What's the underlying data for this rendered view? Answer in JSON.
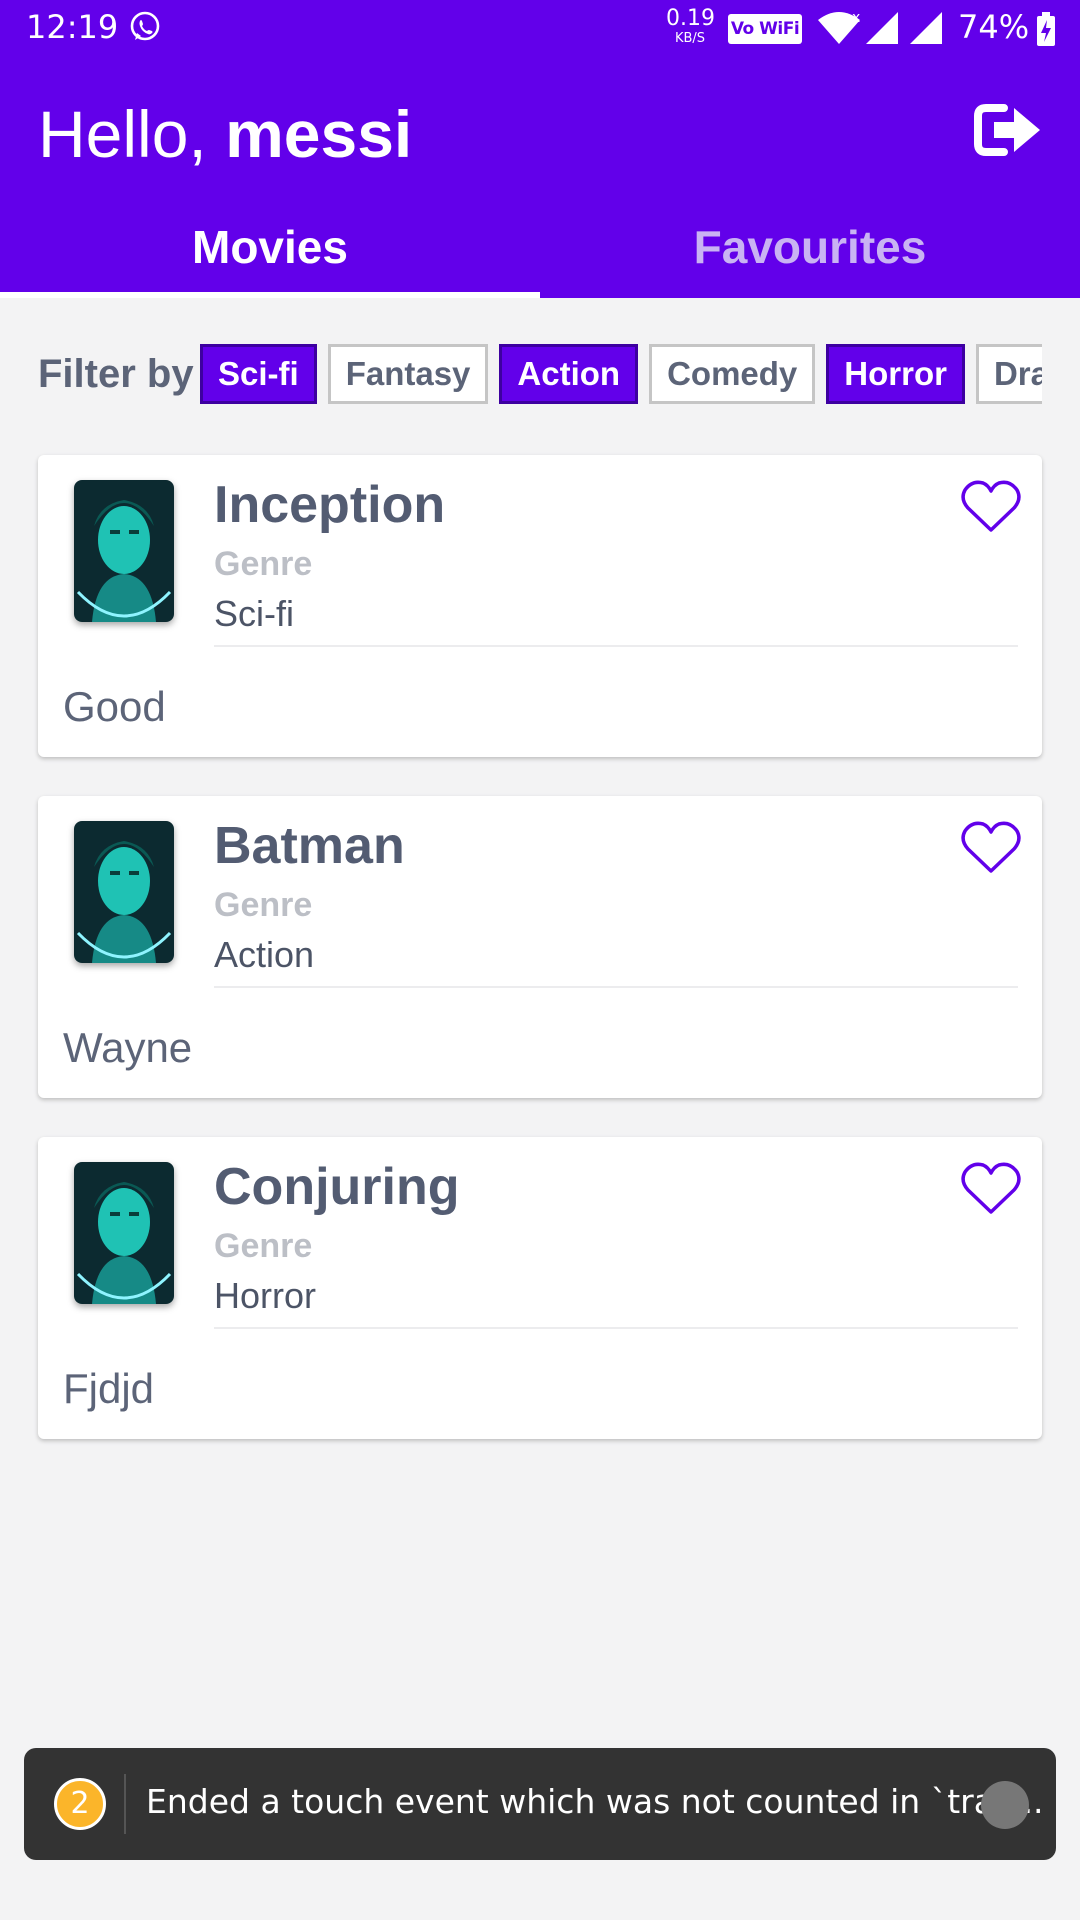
{
  "status_bar": {
    "time": "12:19",
    "net_speed": "0.19",
    "net_unit": "KB/S",
    "vowifi": "Vo WiFi",
    "wifi_x": "x",
    "battery": "74%",
    "icons": [
      "whatsapp-icon",
      "wifi-icon",
      "signal-icon",
      "battery-charging-icon"
    ]
  },
  "header": {
    "greeting": "Hello,",
    "username": "messi",
    "logout_icon": "logout-icon",
    "background": "#6200ea"
  },
  "tabs": [
    {
      "label": "Movies",
      "selected": true
    },
    {
      "label": "Favourites",
      "selected": false
    }
  ],
  "filter": {
    "label": "Filter by",
    "chips": [
      {
        "label": "Sci-fi",
        "selected": true
      },
      {
        "label": "Fantasy",
        "selected": false
      },
      {
        "label": "Action",
        "selected": true
      },
      {
        "label": "Comedy",
        "selected": false
      },
      {
        "label": "Horror",
        "selected": true
      },
      {
        "label": "Drama",
        "selected": false
      }
    ]
  },
  "movies": [
    {
      "title": "Inception",
      "genre_label": "Genre",
      "genre": "Sci-fi",
      "description": "Good",
      "favourite_icon": "heart-outline-icon"
    },
    {
      "title": "Batman",
      "genre_label": "Genre",
      "genre": "Action",
      "description": "Wayne",
      "favourite_icon": "heart-outline-icon"
    },
    {
      "title": "Conjuring",
      "genre_label": "Genre",
      "genre": "Horror",
      "description": "Fjdjd",
      "favourite_icon": "heart-outline-icon"
    }
  ],
  "toast": {
    "count": "2",
    "message": "Ended a touch event which was not counted in `trac..."
  },
  "colors": {
    "accent": "#6200ea",
    "text_primary": "#535c72",
    "text_muted": "#bcbfc6",
    "background": "#f3f3f4",
    "tab_inactive": "#c9b3f3"
  }
}
